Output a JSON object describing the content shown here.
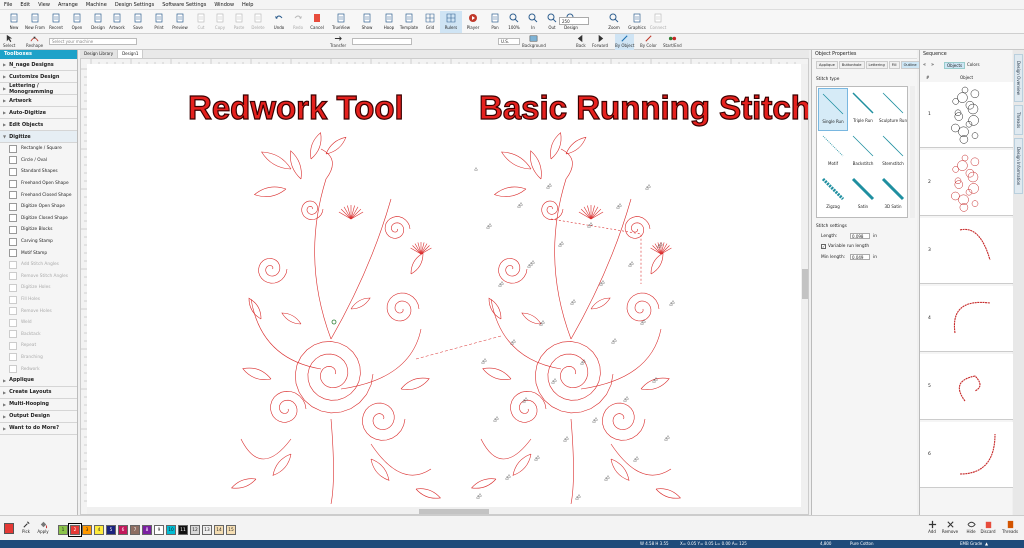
{
  "menu": [
    "File",
    "Edit",
    "View",
    "Arrange",
    "Machine",
    "Design Settings",
    "Software Settings",
    "Window",
    "Help"
  ],
  "ribbon": [
    "New",
    "New From",
    "Recent",
    "Open",
    "Design",
    "Artwork",
    "Save",
    "Print",
    "Preview",
    "Cut",
    "Copy",
    "Paste",
    "Delete",
    "Undo",
    "Redo",
    "Cancel",
    "TrueView",
    "Show",
    "Hoop",
    "Template",
    "Grid",
    "Rulers",
    "Player",
    "Pan",
    "100%",
    "In",
    "Out",
    "Design",
    "Zoom",
    "Graphics",
    "Connect"
  ],
  "zoom_value": "250",
  "ribbon2": {
    "select": "Select",
    "reshape": "Reshape",
    "machine_placeholder": "Select your machine",
    "transfer": "Transfer",
    "units": "U.S.",
    "background": "Background",
    "back": "Back",
    "forward": "Forward",
    "by_object": "By Object",
    "by_color": "By Color",
    "start_end": "Start/End"
  },
  "toolbox": {
    "title": "Toolboxes",
    "sections_top": [
      "N_nage Designs",
      "Customize Design",
      "Lettering / Monogramming",
      "Artwork",
      "Auto-Digitize",
      "Edit Objects"
    ],
    "digitize": "Digitize",
    "digitize_items": [
      "Rectangle / Square",
      "Circle / Oval",
      "Standard Shapes",
      "Freehand Open Shape",
      "Freehand Closed Shape",
      "Digitize Open Shape",
      "Digitize Closed Shape",
      "Digitize Blocks",
      "Carving Stamp",
      "Motif Stamp",
      "Add Stitch Angles",
      "Remove Stitch Angles",
      "Digitize Holes",
      "Fill Holes",
      "Remove Holes",
      "Weld",
      "Backtack",
      "Repeat",
      "Branching",
      "Redwork"
    ],
    "sections_bottom": [
      "Applique",
      "Create Layouts",
      "Multi-Hooping",
      "Output Design",
      "Want to do More?"
    ]
  },
  "doc_tabs": [
    "Design Library",
    "Design1"
  ],
  "canvas": {
    "left_title": "Redwork Tool",
    "right_title": "Basic Running Stitch"
  },
  "properties": {
    "title": "Object Properties",
    "tabs": [
      "Applique",
      "Buttonhole",
      "Lettering",
      "Fill",
      "Outline"
    ],
    "stitch_type_label": "Stitch type",
    "stitch_types": [
      "Single Run",
      "Triple Run",
      "Sculpture Run",
      "Motif",
      "Backstitch",
      "Stemstitch",
      "Zigzag",
      "Satin",
      "3D Satin"
    ],
    "stitch_settings_label": "Stitch settings",
    "length_label": "Length:",
    "length_value": "0.098",
    "variable_label": "Variable run length",
    "min_length_label": "Min length:",
    "min_length_value": "0.049",
    "unit": "in"
  },
  "sequence": {
    "title": "Sequence",
    "tabs": [
      "Objects",
      "Colors"
    ],
    "col_num": "#",
    "col_obj": "Object",
    "rows": [
      "1",
      "2",
      "3",
      "4",
      "5",
      "6"
    ],
    "bottom_buttons": [
      "Add",
      "Remove",
      "Hide",
      "Discard",
      "Threads"
    ]
  },
  "right_tabs": [
    "Design Overview",
    "Threads",
    "Design Information"
  ],
  "palette": {
    "tools": [
      "Pick",
      "Apply"
    ],
    "swatches": [
      {
        "label": "1",
        "color": "#8bc34a"
      },
      {
        "label": "2",
        "color": "#e53935"
      },
      {
        "label": "3",
        "color": "#ff9800"
      },
      {
        "label": "4",
        "color": "#ffeb3b"
      },
      {
        "label": "5",
        "color": "#1a237e"
      },
      {
        "label": "6",
        "color": "#c2185b"
      },
      {
        "label": "7",
        "color": "#8d6e63"
      },
      {
        "label": "8",
        "color": "#7b1fa2"
      },
      {
        "label": "9",
        "color": "#ffffff"
      },
      {
        "label": "10",
        "color": "#00bcd4"
      },
      {
        "label": "11",
        "color": "#111111"
      },
      {
        "label": "12",
        "color": "#d7d7d7"
      },
      {
        "label": "13",
        "color": "#eeeeee"
      },
      {
        "label": "14",
        "color": "#f5deb3"
      },
      {
        "label": "15",
        "color": "#f5deb3"
      }
    ]
  },
  "status": {
    "dims": "W 4.58 H 3.55",
    "coords": "X= 0.05 Y= 0.05 L= 0.00 A= 125",
    "code": "4,800",
    "thread": "Pure Cotton",
    "grade": "EMB Grade",
    "stitch": "▲"
  }
}
